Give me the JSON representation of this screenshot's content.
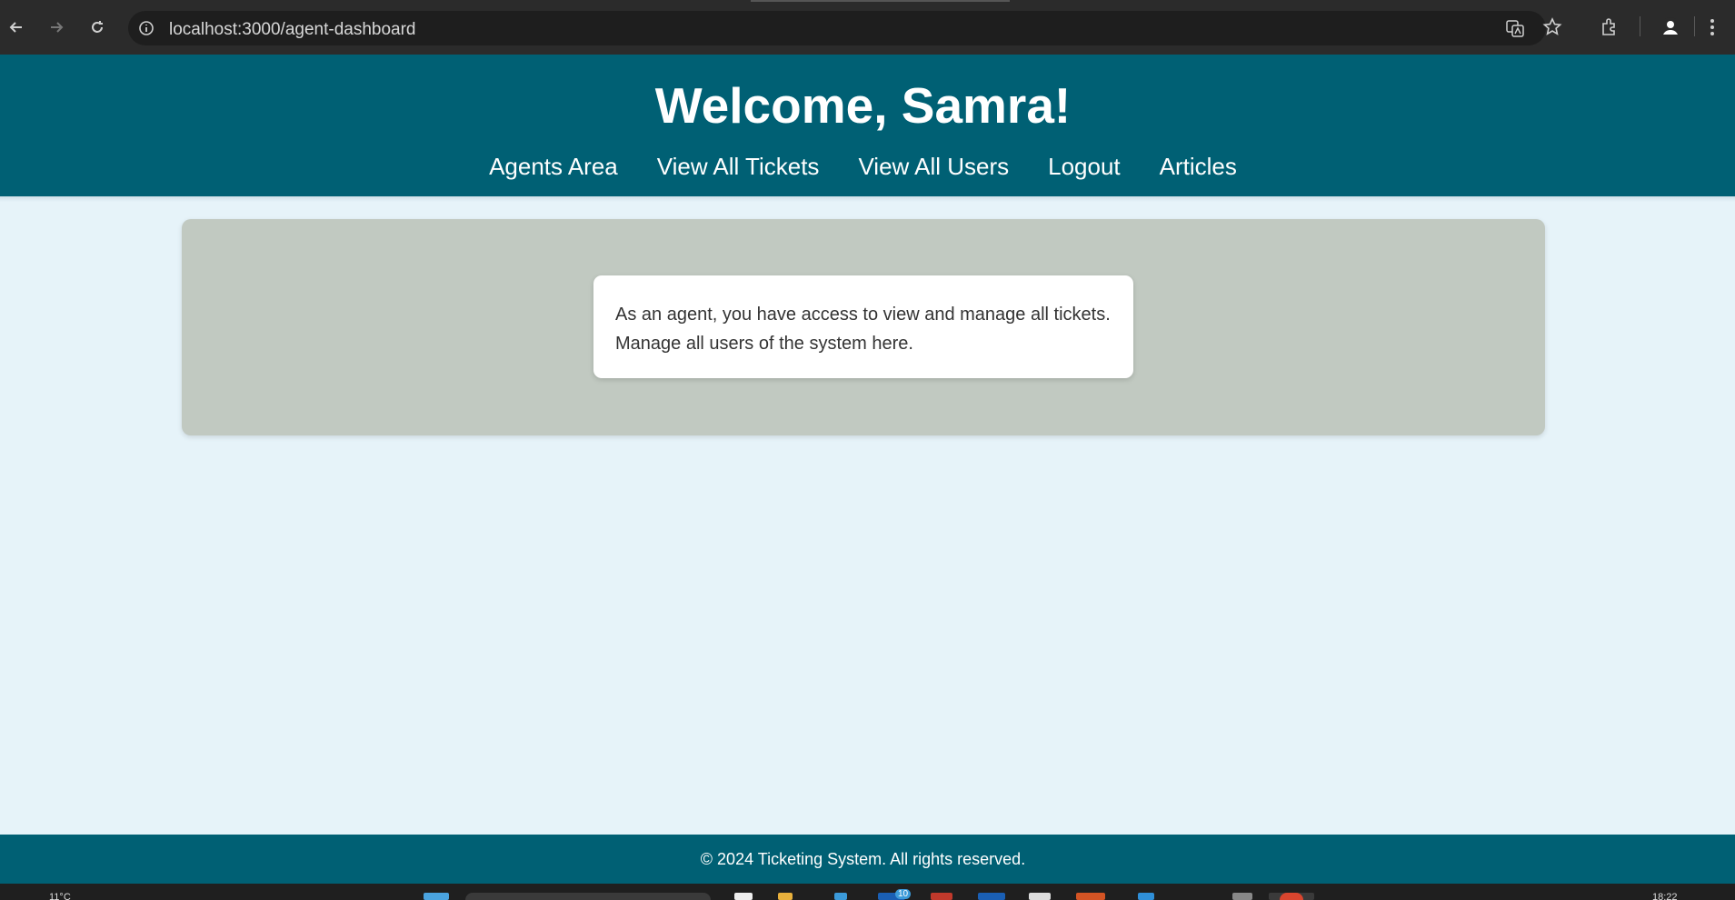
{
  "browser": {
    "url": "localhost:3000/agent-dashboard",
    "icons": [
      "back-icon",
      "forward-icon",
      "reload-icon",
      "info-icon",
      "translate-icon",
      "bookmark-star-icon",
      "extensions-icon",
      "profile-icon",
      "menu-icon"
    ]
  },
  "header": {
    "title": "Welcome, Samra!",
    "nav": [
      "Agents Area",
      "View All Tickets",
      "View All Users",
      "Logout",
      "Articles"
    ]
  },
  "card": {
    "line1": "As an agent, you have access to view and manage all tickets.",
    "line2": "Manage all users of the system here."
  },
  "footer": {
    "text": "© 2024 Ticketing System. All rights reserved."
  },
  "taskbar": {
    "weather": "11°C",
    "badge": "10",
    "time": "18:22"
  },
  "colors": {
    "header_bg": "#006074",
    "page_bg": "#e6f3f9",
    "panel_bg": "#c1c9c1",
    "card_bg": "#ffffff"
  }
}
